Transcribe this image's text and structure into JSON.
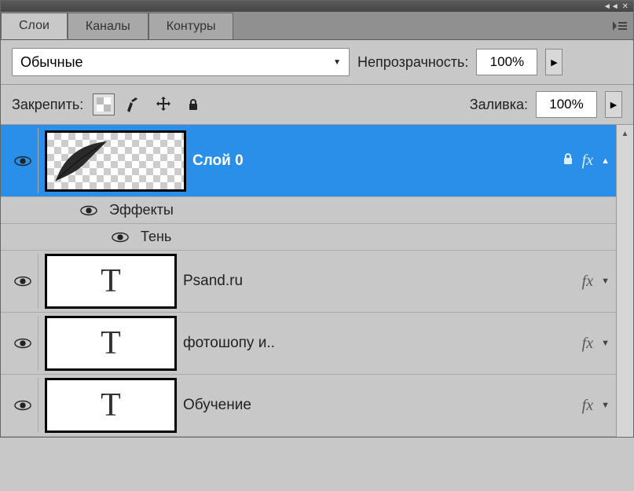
{
  "topbar": {
    "collapse": "◄◄",
    "close": "✕"
  },
  "tabs": {
    "items": [
      {
        "label": "Слои",
        "active": true
      },
      {
        "label": "Каналы",
        "active": false
      },
      {
        "label": "Контуры",
        "active": false
      }
    ]
  },
  "blend": {
    "mode": "Обычные"
  },
  "opacity": {
    "label": "Непрозрачность:",
    "value": "100%"
  },
  "lock": {
    "label": "Закрепить:"
  },
  "fill": {
    "label": "Заливка:",
    "value": "100%"
  },
  "layers": [
    {
      "name": "Слой 0",
      "type": "image",
      "selected": true,
      "locked": true,
      "fx": true,
      "expand": "up",
      "effects": {
        "label": "Эффекты",
        "items": [
          {
            "label": "Тень"
          }
        ]
      }
    },
    {
      "name": "Psand.ru",
      "type": "text",
      "selected": false,
      "fx": true,
      "expand": "down"
    },
    {
      "name": "фотошопу и..",
      "type": "text",
      "selected": false,
      "fx": true,
      "expand": "down"
    },
    {
      "name": "Обучение",
      "type": "text",
      "selected": false,
      "fx": true,
      "expand": "down"
    }
  ]
}
